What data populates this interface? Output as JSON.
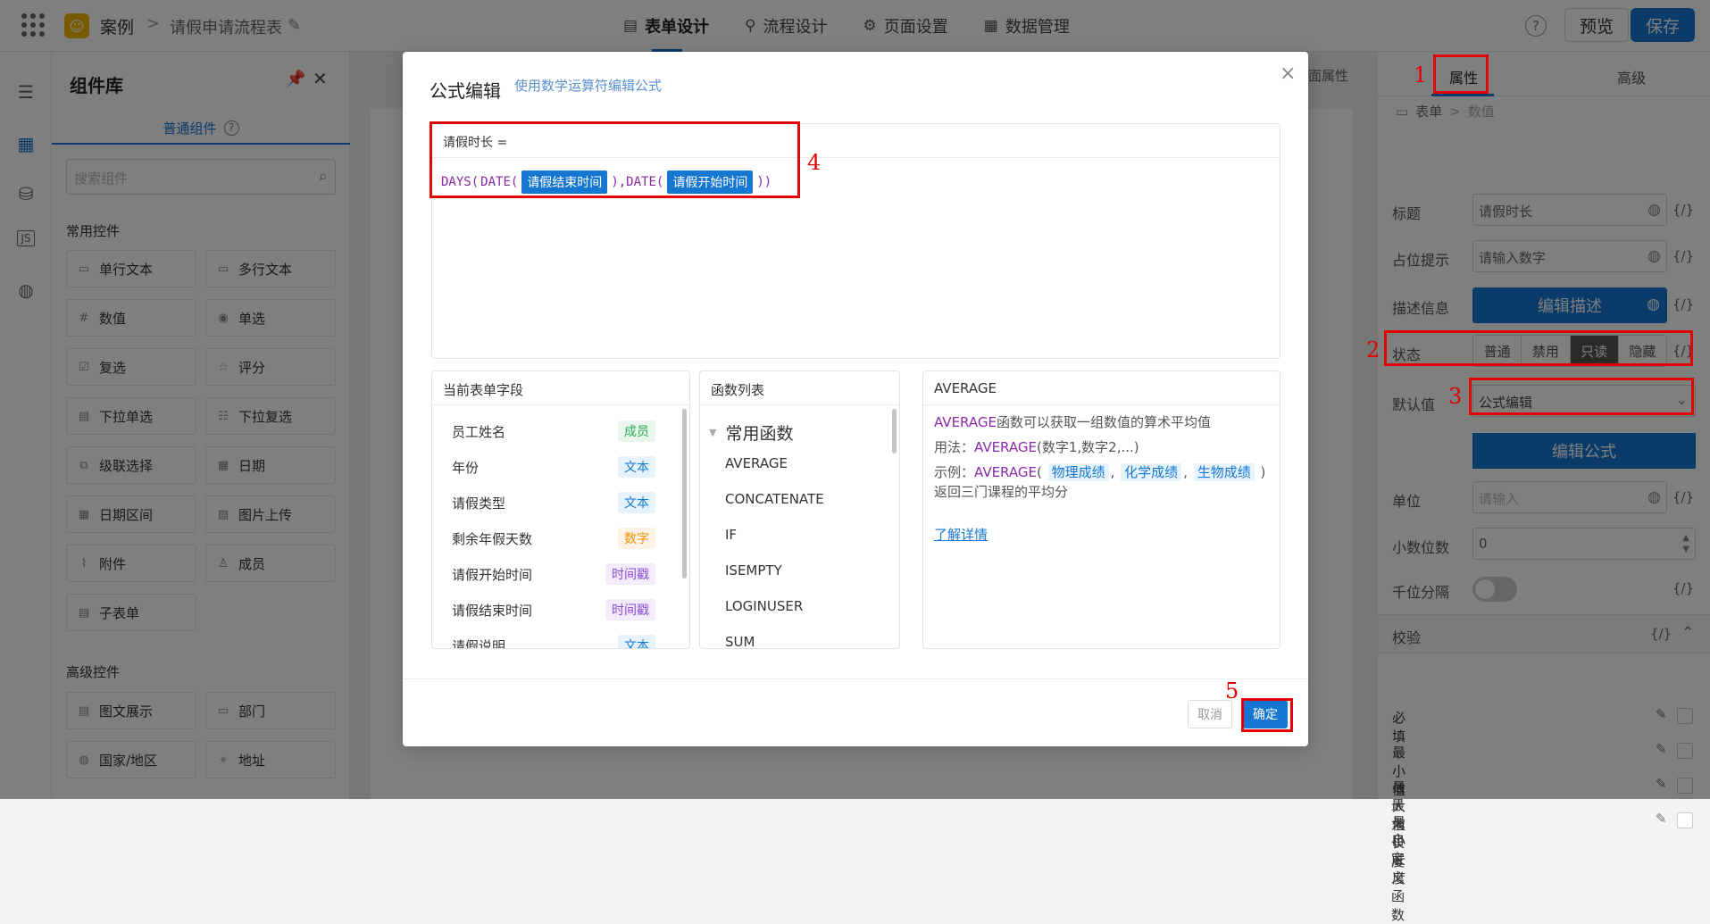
{
  "header": {
    "app_name": "案例",
    "page_name": "请假申请流程表",
    "tabs": [
      {
        "label": "表单设计",
        "icon": "document-icon"
      },
      {
        "label": "流程设计",
        "icon": "flow-icon"
      },
      {
        "label": "页面设置",
        "icon": "gear-icon"
      },
      {
        "label": "数据管理",
        "icon": "table-icon"
      }
    ],
    "preview_label": "预览",
    "save_label": "保存"
  },
  "component_panel": {
    "title": "组件库",
    "tab_label": "普通组件",
    "search_placeholder": "搜索组件",
    "common_group": "常用控件",
    "common_items": [
      "单行文本",
      "多行文本",
      "数值",
      "单选",
      "复选",
      "评分",
      "下拉单选",
      "下拉复选",
      "级联选择",
      "日期",
      "日期区间",
      "图片上传",
      "附件",
      "成员",
      "子表单"
    ],
    "advanced_group": "高级控件",
    "advanced_items": [
      "图文展示",
      "部门",
      "国家/地区",
      "地址"
    ]
  },
  "canvas": {
    "page_prop_tab": "页面属性"
  },
  "right_panel": {
    "tab_props": "属性",
    "tab_advanced": "高级",
    "crumb_form": "表单",
    "crumb_field": "数值",
    "title_label": "标题",
    "title_value": "请假时长",
    "placeholder_label": "占位提示",
    "placeholder_value": "请输入数字",
    "desc_label": "描述信息",
    "desc_button": "编辑描述",
    "state_label": "状态",
    "state_options": [
      "普通",
      "禁用",
      "只读",
      "隐藏"
    ],
    "state_selected": "只读",
    "default_label": "默认值",
    "default_value": "公式编辑",
    "formula_button": "编辑公式",
    "unit_label": "单位",
    "unit_placeholder": "请输入",
    "decimal_label": "小数位数",
    "decimal_value": "0",
    "thousands_label": "千位分隔",
    "var_token": "{/}",
    "validation_title": "校验",
    "rules": [
      "必填",
      "最小值",
      "最大值",
      "最小长度",
      "最大长度",
      "自定义函数"
    ],
    "rules_checked": [
      false,
      false,
      false,
      false,
      true,
      false
    ]
  },
  "modal": {
    "title": "公式编辑",
    "subtitle": "使用数学运算符编辑公式",
    "formula_target": "请假时长 =",
    "formula": {
      "fn1": "DAYS(",
      "fn2": "DATE(",
      "field1": "请假结束时间",
      "mid": "),DATE(",
      "field2": "请假开始时间",
      "end": "))"
    },
    "fields_title": "当前表单字段",
    "fields": [
      {
        "name": "员工姓名",
        "type": "成员",
        "kind": "member"
      },
      {
        "name": "年份",
        "type": "文本",
        "kind": "text"
      },
      {
        "name": "请假类型",
        "type": "文本",
        "kind": "text"
      },
      {
        "name": "剩余年假天数",
        "type": "数字",
        "kind": "num"
      },
      {
        "name": "请假开始时间",
        "type": "时间戳",
        "kind": "time"
      },
      {
        "name": "请假结束时间",
        "type": "时间戳",
        "kind": "time"
      },
      {
        "name": "请假说明",
        "type": "文本",
        "kind": "text"
      }
    ],
    "functions_title": "函数列表",
    "function_group": "常用函数",
    "functions": [
      "AVERAGE",
      "CONCATENATE",
      "IF",
      "ISEMPTY",
      "LOGINUSER",
      "SUM"
    ],
    "help": {
      "title": "AVERAGE",
      "line1_fn": "AVERAGE",
      "line1_rest": "函数可以获取一组数值的算术平均值",
      "usage_prefix": "用法：",
      "usage_fn": "AVERAGE",
      "usage_args": "(数字1,数字2,...)",
      "example_prefix": "示例：",
      "example_fn": "AVERAGE",
      "example_args": [
        "物理成绩",
        "化学成绩",
        "生物成绩"
      ],
      "example_result": "返回三门课程的平均分",
      "learn_more": "了解详情"
    },
    "cancel_label": "取消",
    "ok_label": "确定"
  },
  "annotations": [
    "1",
    "2",
    "3",
    "4",
    "5"
  ],
  "colors": {
    "accent": "#1677d2",
    "highlight": "#e40000"
  }
}
